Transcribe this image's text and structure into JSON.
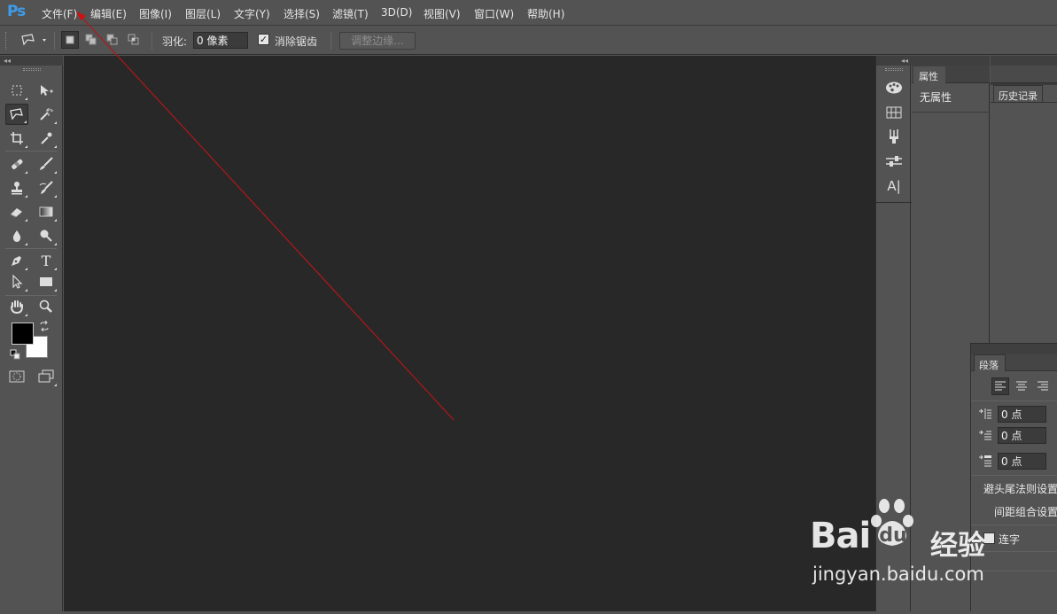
{
  "app": {
    "logo": "Ps"
  },
  "menu": {
    "items": [
      {
        "label": "文件(F)"
      },
      {
        "label": "编辑(E)"
      },
      {
        "label": "图像(I)"
      },
      {
        "label": "图层(L)"
      },
      {
        "label": "文字(Y)"
      },
      {
        "label": "选择(S)"
      },
      {
        "label": "滤镜(T)"
      },
      {
        "label": "3D(D)"
      },
      {
        "label": "视图(V)"
      },
      {
        "label": "窗口(W)"
      },
      {
        "label": "帮助(H)"
      }
    ]
  },
  "options": {
    "tool_icon": "polygonal-lasso-icon",
    "feather_label": "羽化:",
    "feather_value": "0 像素",
    "antialias_label": "消除锯齿",
    "antialias_checked": true,
    "refine_edge_label": "调整边缘..."
  },
  "toolbox": {
    "collapse_glyph": "◂◂",
    "tools": [
      "rectangular-marquee",
      "move",
      "polygonal-lasso",
      "magic-wand",
      "crop",
      "eyedropper",
      "healing-brush",
      "brush",
      "clone-stamp",
      "history-brush",
      "eraser",
      "gradient",
      "blur",
      "dodge",
      "pen",
      "type",
      "path-selection",
      "rectangle",
      "hand",
      "zoom"
    ],
    "type_glyph": "T",
    "foreground_color": "#000000",
    "background_color": "#ffffff"
  },
  "canvas": {
    "background": "#282828"
  },
  "icon_strip": {
    "collapse_glyph": "◂◂",
    "icons": [
      "color-palette-icon",
      "swatches-grid-icon",
      "brush-presets-icon",
      "adjustments-icon",
      "character-icon"
    ],
    "character_glyph": "A|"
  },
  "properties": {
    "tab_label": "属性",
    "empty_text": "无属性"
  },
  "history": {
    "tab_label": "历史记录"
  },
  "paragraph": {
    "tab_label": "段落",
    "indent_left": "0 点",
    "indent_first": "0 点",
    "space_before": "0 点",
    "kinsoku_label": "避头尾法则设置",
    "mojikumi_label": "间距组合设置",
    "hyphenate_label": "连字"
  },
  "watermark": {
    "brand_left": "Bai",
    "brand_right": "经验",
    "url": "jingyan.baidu.com"
  },
  "colors": {
    "accent": "#3d9be9",
    "annotation": "#b01818"
  }
}
